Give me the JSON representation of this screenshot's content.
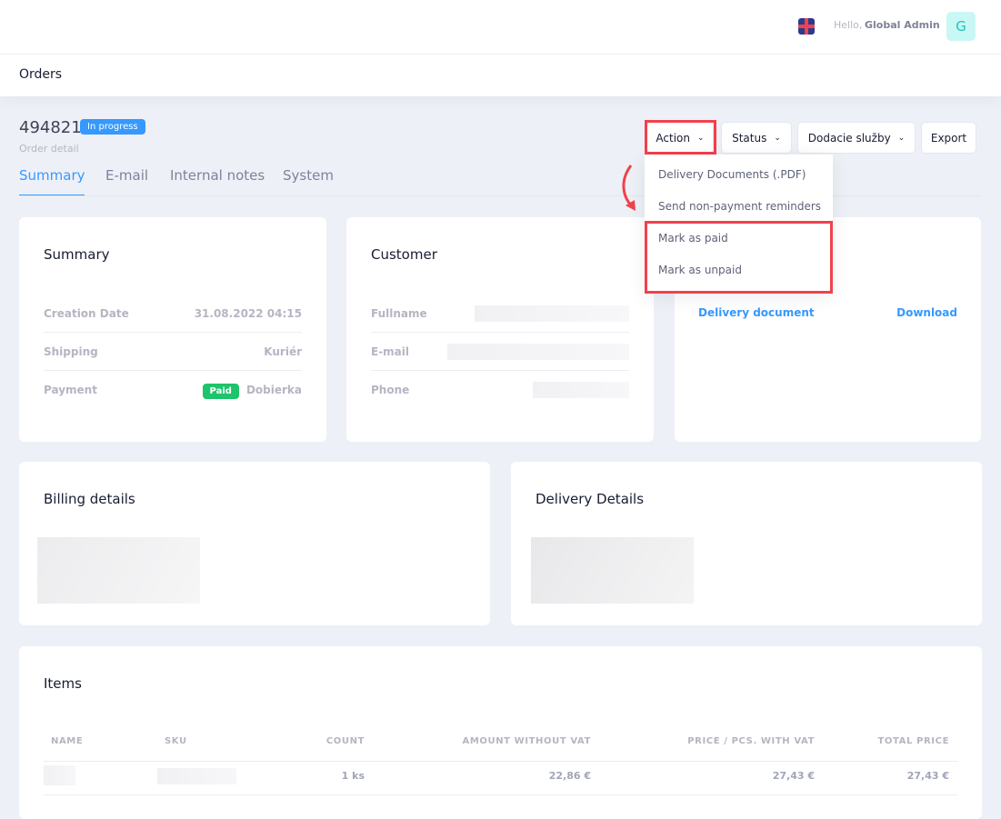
{
  "header": {
    "greeting": "Hello,",
    "user_name": "Global Admin",
    "avatar_letter": "G",
    "language_icon": "uk-flag-icon"
  },
  "page": {
    "title": "Orders",
    "order_number": "494821",
    "status_badge": "In progress",
    "subtitle": "Order detail"
  },
  "tabs": [
    {
      "label": "Summary",
      "active": true
    },
    {
      "label": "E-mail"
    },
    {
      "label": "Internal notes"
    },
    {
      "label": "System"
    }
  ],
  "toolbar": {
    "action": "Action",
    "status": "Status",
    "delivery": "Dodacie služby",
    "export": "Export"
  },
  "action_menu": [
    "Delivery Documents (.PDF)",
    "Send non-payment reminders",
    "Mark as paid",
    "Mark as unpaid"
  ],
  "summary": {
    "title": "Summary",
    "rows": [
      {
        "label": "Creation Date",
        "value": "31.08.2022 04:15"
      },
      {
        "label": "Shipping",
        "value": "Kuriér"
      },
      {
        "label": "Payment",
        "badge": "Paid",
        "value": "Dobierka"
      }
    ]
  },
  "customer": {
    "title": "Customer",
    "fields": [
      "Fullname",
      "E-mail",
      "Phone"
    ]
  },
  "documents": {
    "link": "Delivery document",
    "download": "Download"
  },
  "billing": {
    "title": "Billing details"
  },
  "delivery": {
    "title": "Delivery Details"
  },
  "items": {
    "title": "Items",
    "columns": [
      "NAME",
      "SKU",
      "COUNT",
      "AMOUNT WITHOUT VAT",
      "PRICE / PCS. WITH VAT",
      "TOTAL PRICE"
    ],
    "rows": [
      {
        "count": "1 ks",
        "amount": "22,86 €",
        "price": "27,43 €",
        "total": "27,43 €"
      }
    ]
  },
  "colors": {
    "accent": "#3699ff",
    "paid": "#1bc5bd",
    "highlight": "#f1414b"
  }
}
